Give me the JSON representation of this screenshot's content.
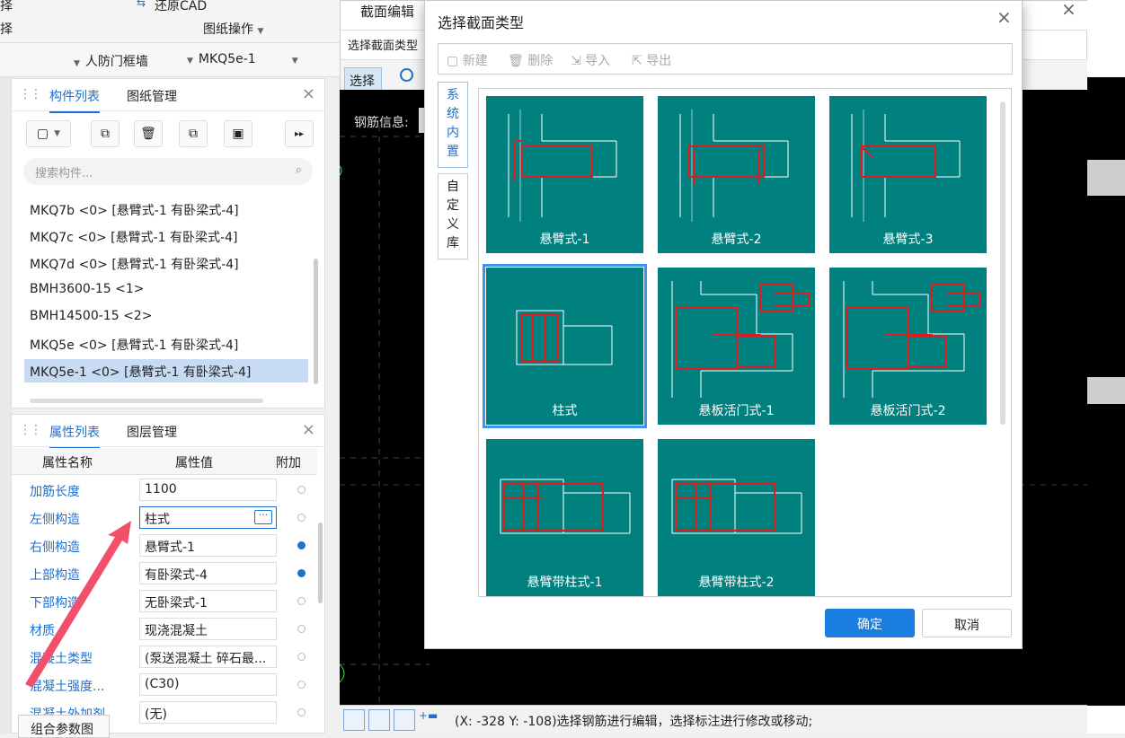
{
  "toolbar": {
    "top_label_1": "择",
    "top_label_2": "择",
    "restore_cad": "还原CAD",
    "drawing_ops": "图纸操作",
    "filter1": "人防门框墙",
    "filter2": "MKQ5e-1"
  },
  "component_panel": {
    "tab_active": "构件列表",
    "tab_other": "图纸管理",
    "search_placeholder": "搜索构件...",
    "items": [
      {
        "label": "MKQ7b <0> [悬臂式-1 有卧梁式-4]"
      },
      {
        "label": "MKQ7c <0> [悬臂式-1 有卧梁式-4]"
      },
      {
        "label": "MKQ7d <0> [悬臂式-1 有卧梁式-4]"
      },
      {
        "label": "BMH3600-15 <1>"
      },
      {
        "label": "BMH14500-15 <2>"
      },
      {
        "label": "MKQ5e <0> [悬臂式-1 有卧梁式-4]"
      },
      {
        "label": "MKQ5e-1 <0> [悬臂式-1 有卧梁式-4]",
        "selected": true
      }
    ]
  },
  "property_panel": {
    "tab_active": "属性列表",
    "tab_other": "图层管理",
    "col_name": "属性名称",
    "col_value": "属性值",
    "col_extra": "附加",
    "rows": [
      {
        "name": "加筋长度",
        "value": "1100",
        "extra": false
      },
      {
        "name": "左侧构造",
        "value": "柱式",
        "extra": false
      },
      {
        "name": "右侧构造",
        "value": "悬臂式-1",
        "extra": true
      },
      {
        "name": "上部构造",
        "value": "有卧梁式-4",
        "extra": true
      },
      {
        "name": "下部构造",
        "value": "无卧梁式-1",
        "extra": false
      },
      {
        "name": "材质",
        "value": "现浇混凝土",
        "extra": false
      },
      {
        "name": "混凝土类型",
        "value": "(泵送混凝土 碎石最...",
        "extra": false
      },
      {
        "name": "混凝土强度...",
        "value": "(C30)",
        "extra": false
      },
      {
        "name": "混凝土外加剂",
        "value": "(无)",
        "extra": false
      }
    ],
    "bottom_button": "组合参数图"
  },
  "editor": {
    "title": "截面编辑",
    "select_section_label": "选择截面类型",
    "select_btn": "选择",
    "rebar_info_label": "钢筋信息:",
    "status_text": "(X: -328 Y: -108)选择钢筋进行编辑，选择标注进行修改或移动;"
  },
  "dialog": {
    "title": "选择截面类型",
    "tools": {
      "new": "新建",
      "delete": "删除",
      "import": "导入",
      "export": "导出"
    },
    "side_tabs": {
      "builtin": "系统内置",
      "custom": "自定义库"
    },
    "tiles": [
      {
        "label": "悬臂式-1"
      },
      {
        "label": "悬臂式-2"
      },
      {
        "label": "悬臂式-3"
      },
      {
        "label": "柱式",
        "selected": true
      },
      {
        "label": "悬板活门式-1"
      },
      {
        "label": "悬板活门式-2"
      },
      {
        "label": "悬臂带柱式-1"
      },
      {
        "label": "悬臂带柱式-2"
      }
    ],
    "ok": "确定",
    "cancel": "取消"
  },
  "colors": {
    "accent": "#1c6fd1",
    "tile_bg": "#00807e",
    "rebar": "#e01b1b",
    "arrow": "#f2506a"
  }
}
